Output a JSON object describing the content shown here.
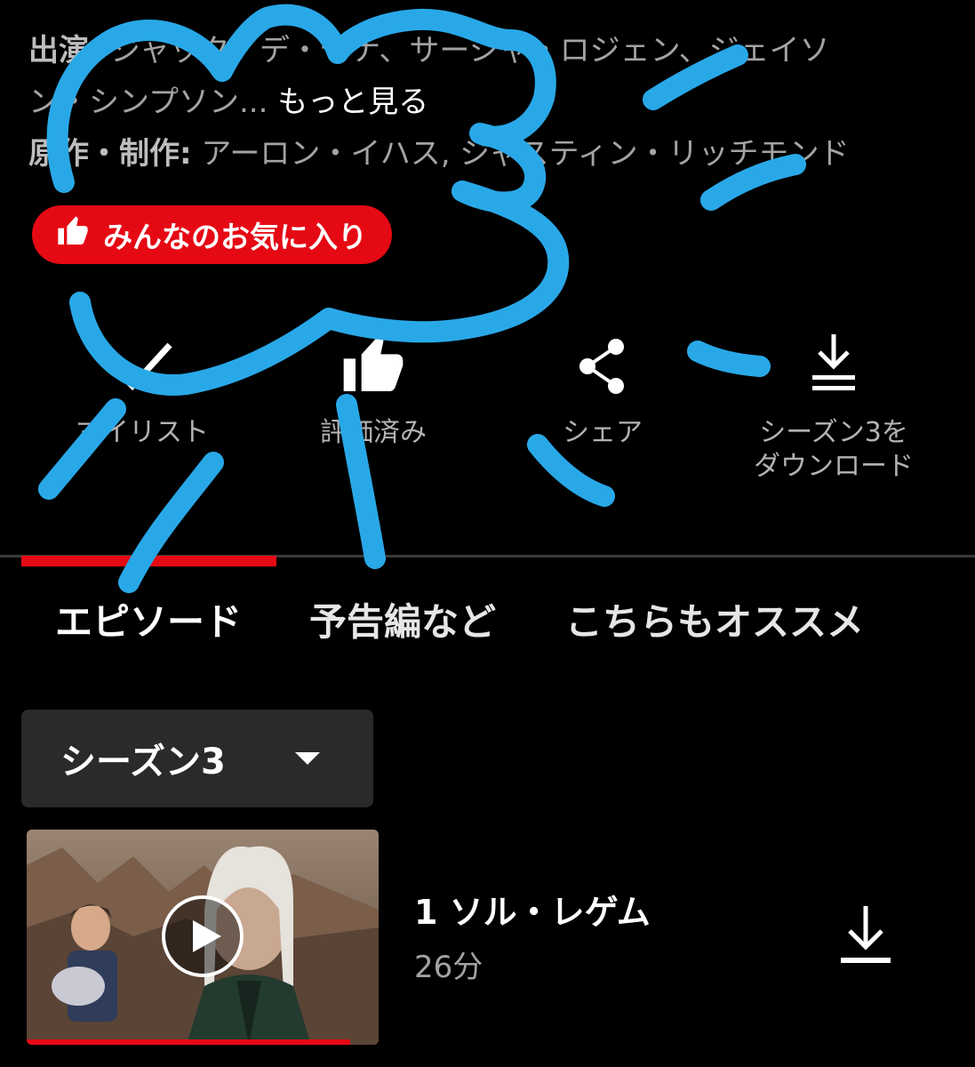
{
  "credits": {
    "cast_label": "出演:",
    "cast_line1": "ジャック・デ・セナ、サーシャ・ロジェン、ジェイソ",
    "cast_line2": "ン・シンプソン...",
    "more_label": "もっと見る",
    "creators_label": "原作・制作:",
    "creators_value": "アーロン・イハス, ジャスティン・リッチモンド"
  },
  "badge": {
    "label": "みんなのお気に入り",
    "color": "#e50914",
    "icon": "thumbs-up-icon"
  },
  "actions": [
    {
      "label": "マイリスト",
      "icon": "check-icon"
    },
    {
      "label": "評価済み",
      "icon": "thumbs-up-icon"
    },
    {
      "label": "シェア",
      "icon": "share-icon"
    },
    {
      "label": "シーズン3を",
      "label2": "ダウンロード",
      "icon": "download-icon"
    }
  ],
  "tabs": [
    {
      "label": "エピソード",
      "active": true
    },
    {
      "label": "予告編など",
      "active": false
    },
    {
      "label": "こちらもオススメ",
      "active": false
    }
  ],
  "season_select": {
    "selected": "シーズン3"
  },
  "episodes": [
    {
      "title": "1 ソル・レゲム",
      "duration": "26分",
      "progress": 0.92
    }
  ],
  "colors": {
    "accent": "#e50914",
    "background": "#000000",
    "scribble": "#29a8e8"
  }
}
